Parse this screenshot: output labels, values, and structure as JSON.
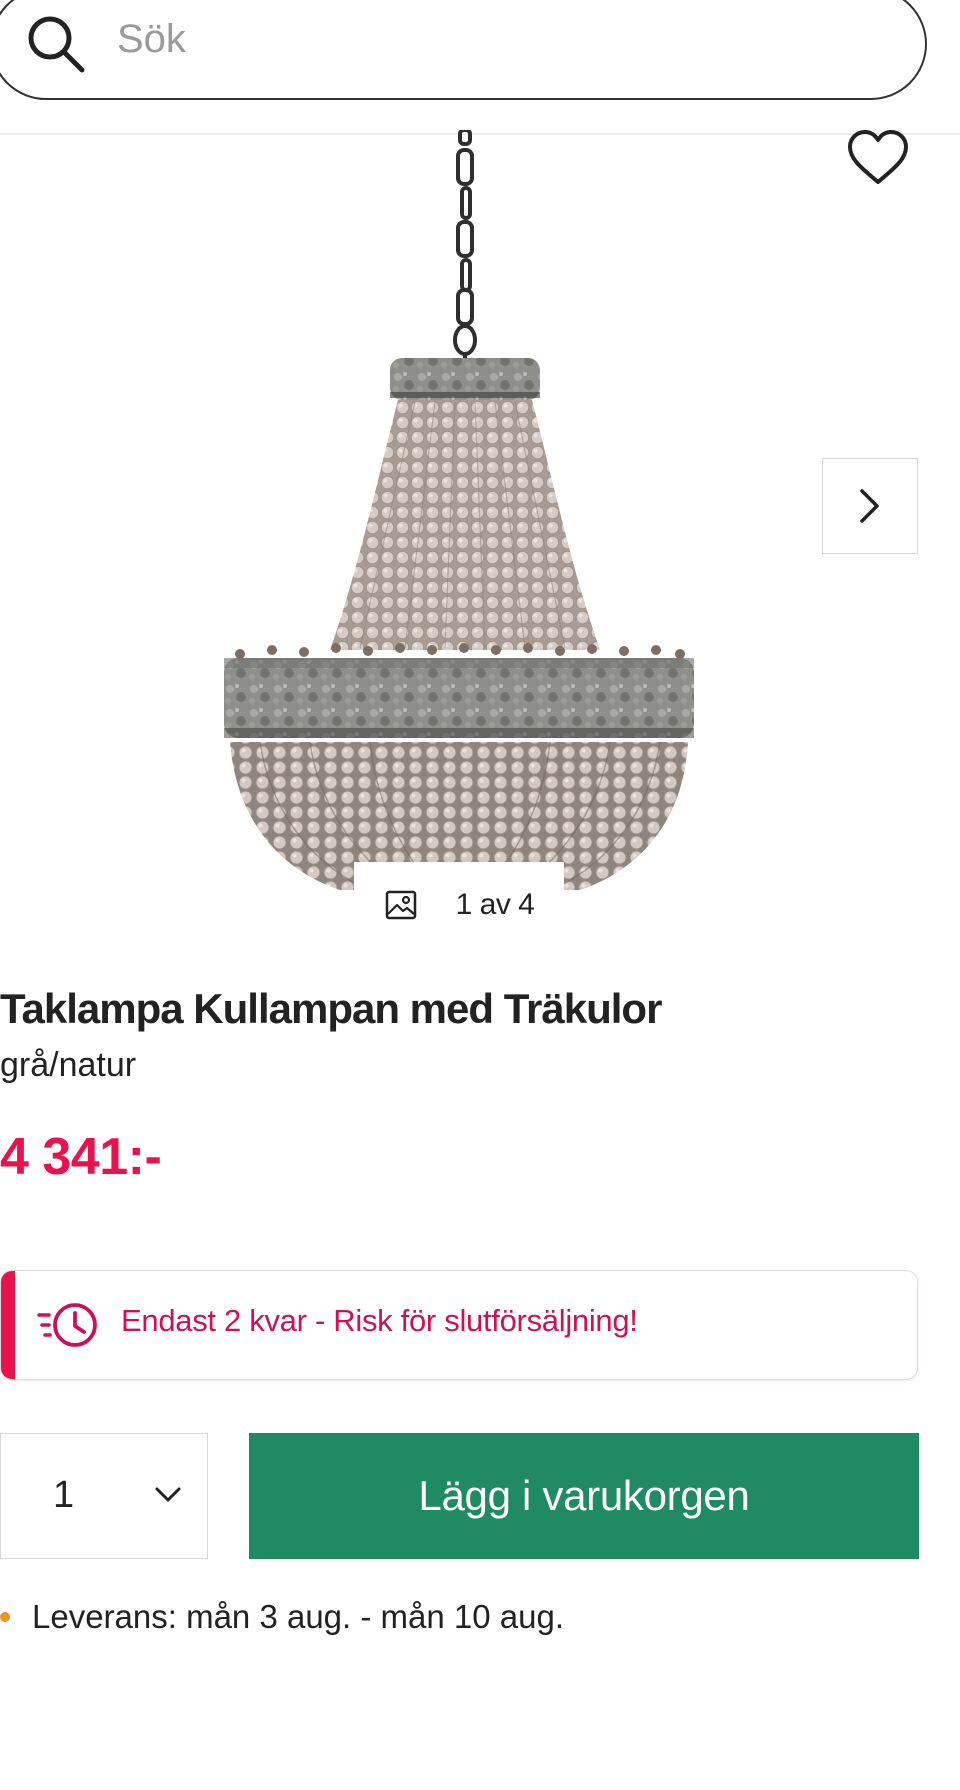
{
  "search": {
    "placeholder": "Sök"
  },
  "gallery": {
    "counter": "1 av 4",
    "icons": {
      "wishlist": "heart-icon",
      "next": "chevron-right-icon",
      "gallery": "image-icon"
    }
  },
  "product": {
    "title": "Taklampa Kullampan med Träkulor",
    "variant": "grå/natur",
    "price": "4 341:-"
  },
  "stock_alert": {
    "text": "Endast 2 kvar - Risk för slutförsäljning!",
    "icon": "clock-icon"
  },
  "purchase": {
    "quantity": "1",
    "add_to_cart_label": "Lägg i varukorgen"
  },
  "delivery": {
    "text": "Leverans: mån 3 aug. - mån 10 aug."
  },
  "colors": {
    "price": "#e8134e",
    "alert_text": "#c9125a",
    "alert_bar": "#e8134e",
    "cart_button": "#1f8a63",
    "delivery_dot": "#e8961d"
  }
}
